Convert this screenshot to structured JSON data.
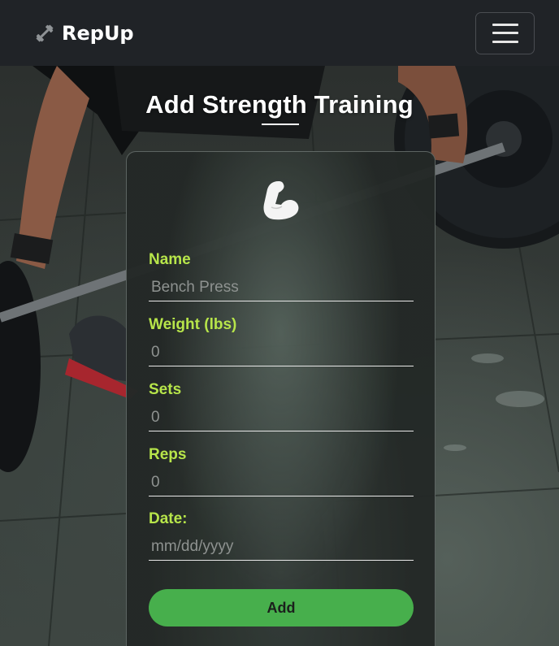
{
  "navbar": {
    "brand_name": "RepUp",
    "brand_icon": "dumbbell-icon",
    "menu_icon": "hamburger-menu-icon"
  },
  "page": {
    "title": "Add Strength Training"
  },
  "form": {
    "header_icon": "flexed-biceps-icon",
    "fields": [
      {
        "label": "Name",
        "placeholder": "Bench Press",
        "type": "text"
      },
      {
        "label": "Weight (lbs)",
        "placeholder": "0",
        "type": "number"
      },
      {
        "label": "Sets",
        "placeholder": "0",
        "type": "number"
      },
      {
        "label": "Reps",
        "placeholder": "0",
        "type": "number"
      },
      {
        "label": "Date:",
        "placeholder": "mm/dd/yyyy",
        "type": "text"
      }
    ],
    "submit_label": "Add"
  },
  "colors": {
    "navbar_bg": "#202327",
    "label_accent": "#b7e54a",
    "button_bg": "#47af4c"
  }
}
